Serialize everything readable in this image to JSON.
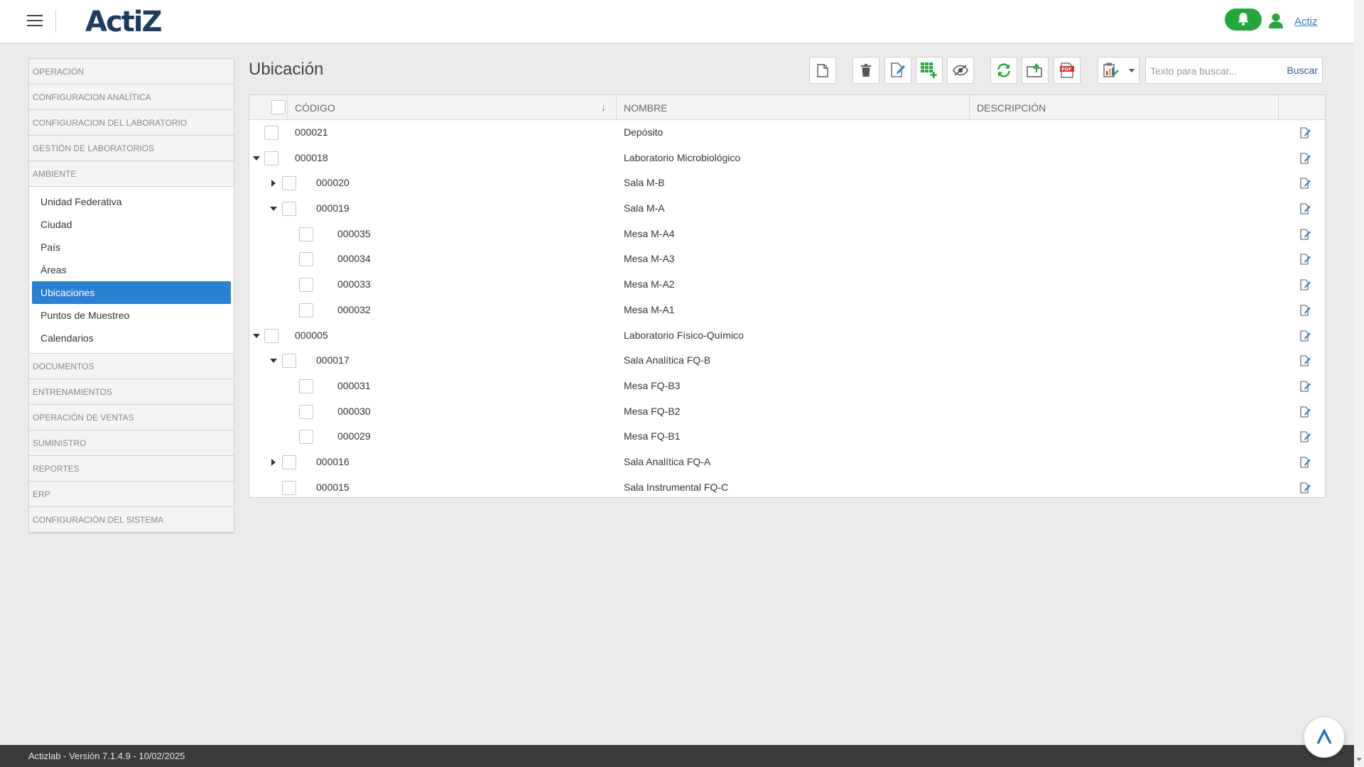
{
  "header": {
    "logo_text": "ActiZ",
    "user_label": "Actiz"
  },
  "sidebar": {
    "groups_before": [
      "OPERACIÓN",
      "CONFIGURACION ANALÍTICA",
      "CONFIGURACION DEL LABORATORIO",
      "GESTIÓN DE LABORATORIOS",
      "AMBIENTE"
    ],
    "submenu": [
      "Unidad Federativa",
      "Ciudad",
      "País",
      "Áreas",
      "Ubicaciones",
      "Puntos de Muestreo",
      "Calendarios"
    ],
    "active_submenu": "Ubicaciones",
    "groups_after": [
      "DOCUMENTOS",
      "ENTRENAMIENTOS",
      "OPERACIÓN DE VENTAS",
      "SUMINISTRO",
      "REPORTES",
      "ERP",
      "CONFIGURACIÓN DEL SISTEMA"
    ]
  },
  "page": {
    "title": "Ubicación"
  },
  "toolbar": {
    "icons": [
      "new-document-icon",
      "delete-icon",
      "edit-icon",
      "add-grid-icon",
      "hide-icon",
      "refresh-icon",
      "export-icon",
      "pdf-icon",
      "report-icon"
    ],
    "search_placeholder": "Texto para buscar...",
    "search_button": "Buscar"
  },
  "table": {
    "columns": [
      "CÓDIGO",
      "NOMBRE",
      "DESCRIPCIÓN"
    ],
    "rows": [
      {
        "level": 0,
        "expander": "",
        "code": "000021",
        "name": "Depósito"
      },
      {
        "level": 0,
        "expander": "down",
        "code": "000018",
        "name": "Laboratorio Microbiológico"
      },
      {
        "level": 1,
        "expander": "right",
        "code": "000020",
        "name": "Sala M-B"
      },
      {
        "level": 1,
        "expander": "down",
        "code": "000019",
        "name": "Sala M-A"
      },
      {
        "level": 2,
        "expander": "",
        "code": "000035",
        "name": "Mesa M-A4"
      },
      {
        "level": 2,
        "expander": "",
        "code": "000034",
        "name": "Mesa M-A3"
      },
      {
        "level": 2,
        "expander": "",
        "code": "000033",
        "name": "Mesa M-A2"
      },
      {
        "level": 2,
        "expander": "",
        "code": "000032",
        "name": "Mesa M-A1"
      },
      {
        "level": 0,
        "expander": "down",
        "code": "000005",
        "name": "Laboratorio Físico-Químico"
      },
      {
        "level": 1,
        "expander": "down",
        "code": "000017",
        "name": "Sala Analítica FQ-B"
      },
      {
        "level": 2,
        "expander": "",
        "code": "000031",
        "name": "Mesa FQ-B3"
      },
      {
        "level": 2,
        "expander": "",
        "code": "000030",
        "name": "Mesa FQ-B2"
      },
      {
        "level": 2,
        "expander": "",
        "code": "000029",
        "name": "Mesa FQ-B1"
      },
      {
        "level": 1,
        "expander": "right",
        "code": "000016",
        "name": "Sala Analítica FQ-A"
      },
      {
        "level": 1,
        "expander": "",
        "code": "000015",
        "name": "Sala Instrumental FQ-C"
      }
    ]
  },
  "footer": {
    "version_text": "Actizlab - Versión 7.1.4.9 - 10/02/2025"
  },
  "colors": {
    "accent": "#2a80d2",
    "green": "#22a83a",
    "footer_bg": "#3b3b3b"
  }
}
